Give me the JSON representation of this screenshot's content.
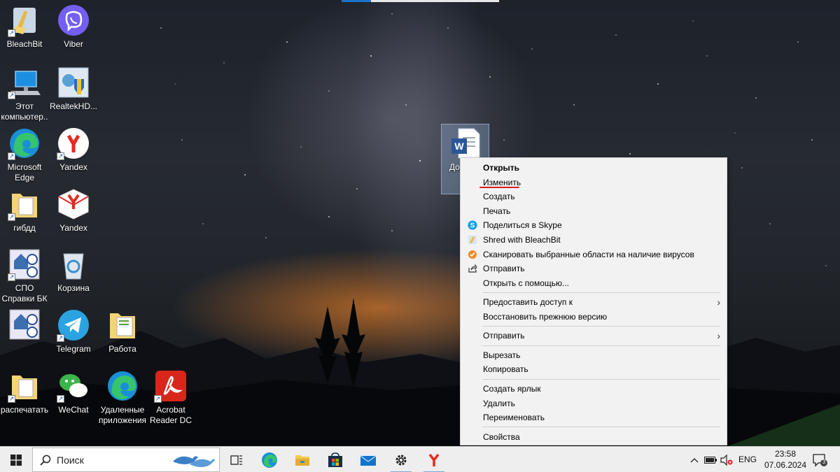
{
  "desktop": {
    "icons": [
      {
        "label": "BleachBit"
      },
      {
        "label": "Viber"
      },
      {
        "label": "Этот компьютер..."
      },
      {
        "label": "RealtekHD..."
      },
      {
        "label": "Microsoft Edge"
      },
      {
        "label": "Yandex"
      },
      {
        "label": "гибдд"
      },
      {
        "label": "Yandex"
      },
      {
        "label": "СПО Справки БК"
      },
      {
        "label": "Корзина"
      },
      {
        "label": "Telegram"
      },
      {
        "label": "Работа"
      },
      {
        "label": "распечатать"
      },
      {
        "label": "WeChat"
      },
      {
        "label": "Удаленные приложения"
      },
      {
        "label": "Acrobat Reader DC"
      }
    ],
    "selected_file": {
      "label": "Док Micr W",
      "icon": "word-document-icon"
    }
  },
  "context_menu": {
    "items": [
      {
        "label": "Открыть",
        "bold": true
      },
      {
        "label": "Изменить",
        "highlight": "#d81b1b"
      },
      {
        "label": "Создать"
      },
      {
        "label": "Печать"
      },
      {
        "label": "Поделиться в Skype",
        "icon": "skype-icon"
      },
      {
        "label": "Shred with BleachBit",
        "icon": "bleachbit-icon"
      },
      {
        "label": "Сканировать выбранные области на наличие вирусов",
        "icon": "antivirus-icon"
      },
      {
        "label": "Отправить",
        "icon": "share-icon"
      },
      {
        "label": "Открыть с помощью..."
      },
      {
        "label": "Предоставить доступ к",
        "submenu": true
      },
      {
        "label": "Восстановить прежнюю версию"
      },
      {
        "label": "Отправить",
        "submenu": true
      },
      {
        "label": "Вырезать"
      },
      {
        "label": "Копировать"
      },
      {
        "label": "Создать ярлык"
      },
      {
        "label": "Удалить"
      },
      {
        "label": "Переименовать"
      },
      {
        "label": "Свойства"
      }
    ]
  },
  "taskbar": {
    "search_placeholder": "Поиск",
    "language": "ENG",
    "time": "23:58",
    "date": "07.06.2024",
    "notification_count": "3",
    "pinned": [
      "task-view-icon",
      "edge-icon",
      "file-explorer-icon",
      "store-icon",
      "mail-icon",
      "settings-icon",
      "yandex-icon"
    ]
  },
  "colors": {
    "accent": "#1b74c6",
    "menu_bg": "#f2f2f2",
    "taskbar_bg": "#eeeeee",
    "highlight_red": "#d81b1b"
  }
}
